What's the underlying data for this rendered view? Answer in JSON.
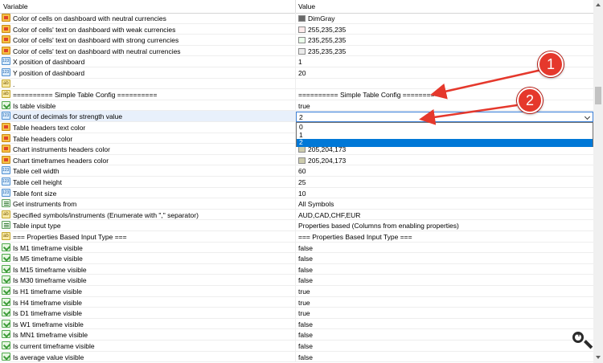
{
  "header": {
    "col_variable": "Variable",
    "col_value": "Value"
  },
  "colors": {
    "dimgray": "#696969",
    "pink": "#ffebeb",
    "mint": "#ebffeb",
    "neutral": "#ebebeb",
    "khaki": "#cdccad",
    "accent": "#0078d7",
    "callout": "#e5382c"
  },
  "rows": [
    {
      "type": "color",
      "name": "Color of cells on dashboard with neutral currencies",
      "value": "DimGray",
      "swatch": "#696969"
    },
    {
      "type": "color",
      "name": "Color of cells' text on dashboard with weak currencies",
      "value": "255,235,235",
      "swatch": "#ffebeb"
    },
    {
      "type": "color",
      "name": "Color of cells' text on dashboard with strong currencies",
      "value": "235,255,235",
      "swatch": "#ebffeb"
    },
    {
      "type": "color",
      "name": "Color of cells' text on dashboard with neutral currencies",
      "value": "235,235,235",
      "swatch": "#ebebeb"
    },
    {
      "type": "int",
      "name": "X position of dashboard",
      "value": "1"
    },
    {
      "type": "int",
      "name": "Y position of dashboard",
      "value": "20"
    },
    {
      "type": "str",
      "name": ".",
      "value": ""
    },
    {
      "type": "str",
      "name": "========== Simple Table Config ==========",
      "value": "========== Simple Table Config =========="
    },
    {
      "type": "bool",
      "name": "Is table visible",
      "value": "true"
    },
    {
      "type": "int",
      "name": "Count of decimals for strength value",
      "value": ""
    },
    {
      "type": "color",
      "name": "Table headers text color",
      "value": ""
    },
    {
      "type": "color",
      "name": "Table headers color",
      "value": ""
    },
    {
      "type": "color",
      "name": "Chart instruments headers color",
      "value": "205,204,173",
      "swatch": "#cdccad"
    },
    {
      "type": "color",
      "name": "Chart timeframes headers color",
      "value": "205,204,173",
      "swatch": "#cdccad"
    },
    {
      "type": "int",
      "name": "Table cell width",
      "value": "60"
    },
    {
      "type": "int",
      "name": "Table cell height",
      "value": "25"
    },
    {
      "type": "int",
      "name": "Table font size",
      "value": "10"
    },
    {
      "type": "enum",
      "name": "Get instruments from",
      "value": "All Symbols"
    },
    {
      "type": "str",
      "name": "Specified symbols/instruments (Enumerate with \",\" separator)",
      "value": "AUD,CAD,CHF,EUR"
    },
    {
      "type": "enum",
      "name": "Table input type",
      "value": "Properties based (Columns from enabling properties)"
    },
    {
      "type": "str",
      "name": "=== Properties Based Input Type ===",
      "value": "=== Properties Based Input Type ==="
    },
    {
      "type": "bool",
      "name": "Is M1 timeframe visible",
      "value": "false"
    },
    {
      "type": "bool",
      "name": "Is M5 timeframe visible",
      "value": "false"
    },
    {
      "type": "bool",
      "name": "Is M15 timeframe visible",
      "value": "false"
    },
    {
      "type": "bool",
      "name": "Is M30 timeframe visible",
      "value": "false"
    },
    {
      "type": "bool",
      "name": "Is H1 timeframe visible",
      "value": "true"
    },
    {
      "type": "bool",
      "name": "Is H4 timeframe visible",
      "value": "true"
    },
    {
      "type": "bool",
      "name": "Is D1 timeframe visible",
      "value": "true"
    },
    {
      "type": "bool",
      "name": "Is W1 timeframe visible",
      "value": "false"
    },
    {
      "type": "bool",
      "name": "Is MN1 timeframe visible",
      "value": "false"
    },
    {
      "type": "bool",
      "name": "Is current timeframe visible",
      "value": "false"
    },
    {
      "type": "bool",
      "name": "Is average value visible",
      "value": "false"
    }
  ],
  "dropdown": {
    "selected": "2",
    "options": [
      "0",
      "1",
      "2"
    ],
    "highlighted_index": 2
  },
  "callouts": [
    "1",
    "2"
  ],
  "icons": {
    "zoom": "zoom-in-icon",
    "scroll_up": "chevron-up-icon",
    "scroll_down": "chevron-down-icon",
    "dropdown_arrow": "chevron-down-icon"
  }
}
